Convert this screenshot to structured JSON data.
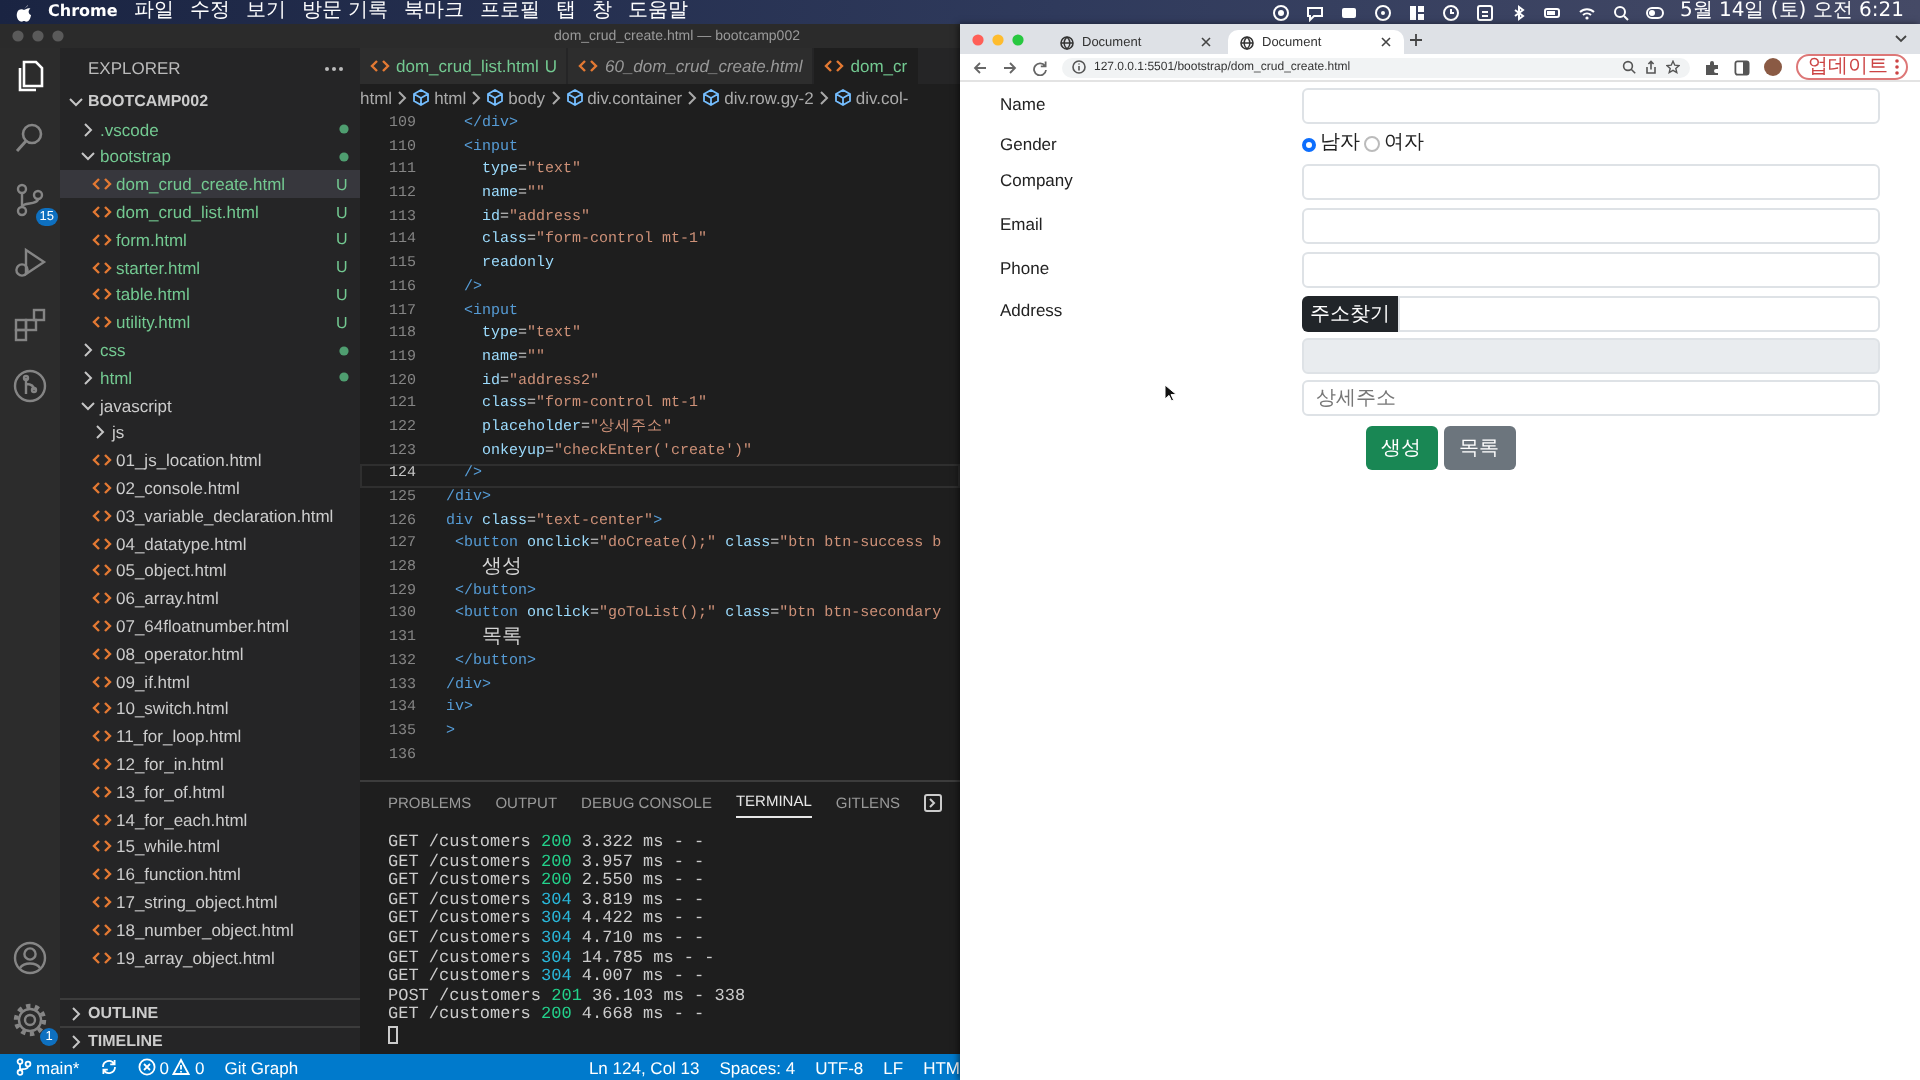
{
  "menu_bar": {
    "app": "Chrome",
    "menus": [
      "파일",
      "수정",
      "보기",
      "방문 기록",
      "북마크",
      "프로필",
      "탭",
      "창",
      "도움말"
    ],
    "clock": "5월 14일 (토) 오전 6:21"
  },
  "editor_window": {
    "title": "dom_crud_create.html — bootcamp002",
    "focused": false,
    "activity_bar": {
      "items": [
        {
          "kind": "files",
          "selected": true
        },
        {
          "kind": "search",
          "selected": false
        },
        {
          "kind": "source_control",
          "selected": false,
          "badge": "15"
        },
        {
          "kind": "run_debug",
          "selected": false
        },
        {
          "kind": "extensions",
          "selected": false
        },
        {
          "kind": "git_graph",
          "selected": false
        }
      ],
      "bottom_items": [
        {
          "kind": "account",
          "selected": false
        },
        {
          "kind": "settings",
          "selected": false,
          "badge": "1"
        }
      ]
    },
    "sidebar": {
      "title": "EXPLORER",
      "root": {
        "label": "BOOTCAMP002",
        "expanded": true
      },
      "tree": [
        {
          "label": ".vscode",
          "kind": "folder",
          "expanded": false,
          "untracked": true,
          "selected": false
        },
        {
          "label": "bootstrap",
          "kind": "folder",
          "expanded": true,
          "untracked": true,
          "selected": false,
          "children": [
            {
              "label": "dom_crud_create.html",
              "kind": "file",
              "untracked": true,
              "badge": "U",
              "selected": true
            },
            {
              "label": "dom_crud_list.html",
              "kind": "file",
              "untracked": true,
              "badge": "U",
              "selected": false
            },
            {
              "label": "form.html",
              "kind": "file",
              "untracked": true,
              "badge": "U",
              "selected": false
            },
            {
              "label": "starter.html",
              "kind": "file",
              "untracked": true,
              "badge": "U",
              "selected": false
            },
            {
              "label": "table.html",
              "kind": "file",
              "untracked": true,
              "badge": "U",
              "selected": false
            },
            {
              "label": "utility.html",
              "kind": "file",
              "untracked": true,
              "badge": "U",
              "selected": false
            }
          ]
        },
        {
          "label": "css",
          "kind": "folder",
          "expanded": false,
          "untracked": true,
          "selected": false
        },
        {
          "label": "html",
          "kind": "folder",
          "expanded": false,
          "untracked": true,
          "selected": false
        },
        {
          "label": "javascript",
          "kind": "folder",
          "expanded": true,
          "untracked": false,
          "selected": false,
          "children": [
            {
              "label": "js",
              "kind": "folder",
              "expanded": false,
              "untracked": false,
              "selected": false
            },
            {
              "label": "01_js_location.html",
              "kind": "file",
              "untracked": false,
              "selected": false
            },
            {
              "label": "02_console.html",
              "kind": "file",
              "untracked": false,
              "selected": false
            },
            {
              "label": "03_variable_declaration.html",
              "kind": "file",
              "untracked": false,
              "selected": false
            },
            {
              "label": "04_datatype.html",
              "kind": "file",
              "untracked": false,
              "selected": false
            },
            {
              "label": "05_object.html",
              "kind": "file",
              "untracked": false,
              "selected": false
            },
            {
              "label": "06_array.html",
              "kind": "file",
              "untracked": false,
              "selected": false
            },
            {
              "label": "07_64floatnumber.html",
              "kind": "file",
              "untracked": false,
              "selected": false
            },
            {
              "label": "08_operator.html",
              "kind": "file",
              "untracked": false,
              "selected": false
            },
            {
              "label": "09_if.html",
              "kind": "file",
              "untracked": false,
              "selected": false
            },
            {
              "label": "10_switch.html",
              "kind": "file",
              "untracked": false,
              "selected": false
            },
            {
              "label": "11_for_loop.html",
              "kind": "file",
              "untracked": false,
              "selected": false
            },
            {
              "label": "12_for_in.html",
              "kind": "file",
              "untracked": false,
              "selected": false
            },
            {
              "label": "13_for_of.html",
              "kind": "file",
              "untracked": false,
              "selected": false
            },
            {
              "label": "14_for_each.html",
              "kind": "file",
              "untracked": false,
              "selected": false
            },
            {
              "label": "15_while.html",
              "kind": "file",
              "untracked": false,
              "selected": false
            },
            {
              "label": "16_function.html",
              "kind": "file",
              "untracked": false,
              "selected": false
            },
            {
              "label": "17_string_object.html",
              "kind": "file",
              "untracked": false,
              "selected": false
            },
            {
              "label": "18_number_object.html",
              "kind": "file",
              "untracked": false,
              "selected": false
            },
            {
              "label": "19_array_object.html",
              "kind": "file",
              "untracked": false,
              "selected": false
            }
          ]
        }
      ],
      "sections": [
        {
          "label": "OUTLINE",
          "expanded": false
        },
        {
          "label": "TIMELINE",
          "expanded": false
        }
      ]
    },
    "tabs": [
      {
        "label": "dom_crud_list.html",
        "badge": "U",
        "untracked": true,
        "preview": false,
        "selected": false
      },
      {
        "label": "60_dom_crud_create.html",
        "untracked": false,
        "preview": true,
        "selected": false
      },
      {
        "label": "dom_cr",
        "untracked": true,
        "preview": false,
        "selected": true
      }
    ],
    "breadcrumb": [
      {
        "label": "html",
        "kind": "folder"
      },
      {
        "label": "html",
        "kind": "element"
      },
      {
        "label": "body",
        "kind": "element"
      },
      {
        "label": "div.container",
        "kind": "element"
      },
      {
        "label": "div.row.gy-2",
        "kind": "element"
      },
      {
        "label": "div.col-",
        "kind": "element"
      }
    ],
    "code": {
      "lines": [
        {
          "number": "109",
          "current": false,
          "tokens": [
            {
              "kind": "tag",
              "text": "  </div>"
            }
          ]
        },
        {
          "number": "110",
          "current": false,
          "tokens": [
            {
              "kind": "tag",
              "text": "  <input"
            }
          ]
        },
        {
          "number": "111",
          "current": false,
          "tokens": [
            {
              "kind": "attr",
              "text": "    type"
            },
            {
              "kind": "punct",
              "text": "="
            },
            {
              "kind": "string",
              "text": "\"text\""
            }
          ]
        },
        {
          "number": "112",
          "current": false,
          "tokens": [
            {
              "kind": "attr",
              "text": "    name"
            },
            {
              "kind": "punct",
              "text": "="
            },
            {
              "kind": "string",
              "text": "\"\""
            }
          ]
        },
        {
          "number": "113",
          "current": false,
          "tokens": [
            {
              "kind": "attr",
              "text": "    id"
            },
            {
              "kind": "punct",
              "text": "="
            },
            {
              "kind": "string",
              "text": "\"address\""
            }
          ]
        },
        {
          "number": "114",
          "current": false,
          "tokens": [
            {
              "kind": "attr",
              "text": "    class"
            },
            {
              "kind": "punct",
              "text": "="
            },
            {
              "kind": "string",
              "text": "\"form-control mt-1\""
            }
          ]
        },
        {
          "number": "115",
          "current": false,
          "tokens": [
            {
              "kind": "attr",
              "text": "    readonly"
            }
          ]
        },
        {
          "number": "116",
          "current": false,
          "tokens": [
            {
              "kind": "tag",
              "text": "  />"
            }
          ]
        },
        {
          "number": "117",
          "current": false,
          "tokens": [
            {
              "kind": "tag",
              "text": "  <input"
            }
          ]
        },
        {
          "number": "118",
          "current": false,
          "tokens": [
            {
              "kind": "attr",
              "text": "    type"
            },
            {
              "kind": "punct",
              "text": "="
            },
            {
              "kind": "string",
              "text": "\"text\""
            }
          ]
        },
        {
          "number": "119",
          "current": false,
          "tokens": [
            {
              "kind": "attr",
              "text": "    name"
            },
            {
              "kind": "punct",
              "text": "="
            },
            {
              "kind": "string",
              "text": "\"\""
            }
          ]
        },
        {
          "number": "120",
          "current": false,
          "tokens": [
            {
              "kind": "attr",
              "text": "    id"
            },
            {
              "kind": "punct",
              "text": "="
            },
            {
              "kind": "string",
              "text": "\"address2\""
            }
          ]
        },
        {
          "number": "121",
          "current": false,
          "tokens": [
            {
              "kind": "attr",
              "text": "    class"
            },
            {
              "kind": "punct",
              "text": "="
            },
            {
              "kind": "string",
              "text": "\"form-control mt-1\""
            }
          ]
        },
        {
          "number": "122",
          "current": false,
          "tokens": [
            {
              "kind": "attr",
              "text": "    placeholder"
            },
            {
              "kind": "punct",
              "text": "="
            },
            {
              "kind": "string",
              "text": "\"상세주소\""
            }
          ]
        },
        {
          "number": "123",
          "current": false,
          "tokens": [
            {
              "kind": "attr",
              "text": "    onkeyup"
            },
            {
              "kind": "punct",
              "text": "="
            },
            {
              "kind": "string",
              "text": "\"checkEnter('create')\""
            }
          ]
        },
        {
          "number": "124",
          "current": true,
          "tokens": [
            {
              "kind": "tag",
              "text": "  />"
            }
          ]
        },
        {
          "number": "125",
          "current": false,
          "tokens": [
            {
              "kind": "tag",
              "text": "/div>"
            }
          ]
        },
        {
          "number": "126",
          "current": false,
          "tokens": [
            {
              "kind": "tag",
              "text": "div"
            },
            {
              "kind": "attr",
              "text": " class"
            },
            {
              "kind": "punct",
              "text": "="
            },
            {
              "kind": "string",
              "text": "\"text-center\""
            },
            {
              "kind": "tag",
              "text": ">"
            }
          ]
        },
        {
          "number": "127",
          "current": false,
          "tokens": [
            {
              "kind": "tag",
              "text": " <button"
            },
            {
              "kind": "attr",
              "text": " onclick"
            },
            {
              "kind": "punct",
              "text": "="
            },
            {
              "kind": "string",
              "text": "\"doCreate();\""
            },
            {
              "kind": "attr",
              "text": " class"
            },
            {
              "kind": "punct",
              "text": "="
            },
            {
              "kind": "string",
              "text": "\"btn btn-success b"
            }
          ]
        },
        {
          "number": "128",
          "current": false,
          "tokens": [
            {
              "kind": "text",
              "text": "   생성"
            }
          ]
        },
        {
          "number": "129",
          "current": false,
          "tokens": [
            {
              "kind": "tag",
              "text": " </button>"
            }
          ]
        },
        {
          "number": "130",
          "current": false,
          "tokens": [
            {
              "kind": "tag",
              "text": " <button"
            },
            {
              "kind": "attr",
              "text": " onclick"
            },
            {
              "kind": "punct",
              "text": "="
            },
            {
              "kind": "string",
              "text": "\"goToList();\""
            },
            {
              "kind": "attr",
              "text": " class"
            },
            {
              "kind": "punct",
              "text": "="
            },
            {
              "kind": "string",
              "text": "\"btn btn-secondary"
            }
          ]
        },
        {
          "number": "131",
          "current": false,
          "tokens": [
            {
              "kind": "text",
              "text": "   목록"
            }
          ]
        },
        {
          "number": "132",
          "current": false,
          "tokens": [
            {
              "kind": "tag",
              "text": " </button>"
            }
          ]
        },
        {
          "number": "133",
          "current": false,
          "tokens": [
            {
              "kind": "tag",
              "text": "/div>"
            }
          ]
        },
        {
          "number": "134",
          "current": false,
          "tokens": [
            {
              "kind": "tag",
              "text": "iv>"
            }
          ]
        },
        {
          "number": "135",
          "current": false,
          "tokens": [
            {
              "kind": "tag",
              "text": ">"
            }
          ]
        },
        {
          "number": "136",
          "current": false
        }
      ]
    },
    "panel": {
      "tabs": [
        {
          "label": "PROBLEMS",
          "selected": false
        },
        {
          "label": "OUTPUT",
          "selected": false
        },
        {
          "label": "DEBUG CONSOLE",
          "selected": false
        },
        {
          "label": "TERMINAL",
          "selected": true
        },
        {
          "label": "GITLENS",
          "selected": false
        }
      ],
      "terminal": [
        {
          "request": "GET /customers",
          "status": "200",
          "kind": "success",
          "rest": "3.322 ms - -"
        },
        {
          "request": "GET /customers",
          "status": "200",
          "kind": "success",
          "rest": "3.957 ms - -"
        },
        {
          "request": "GET /customers",
          "status": "200",
          "kind": "success",
          "rest": "2.550 ms - -"
        },
        {
          "request": "GET /customers",
          "status": "304",
          "kind": "not_modified",
          "rest": "3.819 ms - -"
        },
        {
          "request": "GET /customers",
          "status": "304",
          "kind": "not_modified",
          "rest": "4.422 ms - -"
        },
        {
          "request": "GET /customers",
          "status": "304",
          "kind": "not_modified",
          "rest": "4.710 ms - -"
        },
        {
          "request": "GET /customers",
          "status": "304",
          "kind": "not_modified",
          "rest": "14.785 ms - -"
        },
        {
          "request": "GET /customers",
          "status": "304",
          "kind": "not_modified",
          "rest": "4.007 ms - -"
        },
        {
          "request": "POST /customers",
          "status": "201",
          "kind": "success",
          "rest": "36.103 ms - 338"
        },
        {
          "request": "GET /customers",
          "status": "200",
          "kind": "success",
          "rest": "4.668 ms - -"
        }
      ]
    },
    "status_bar": {
      "branch": "main*",
      "errors": "0",
      "warnings": "0",
      "left_items": [
        "Git Graph"
      ],
      "right_items": [
        "Ln 124, Col 13",
        "Spaces: 4",
        "UTF-8",
        "LF",
        "HTM"
      ]
    }
  },
  "browser": {
    "focused": true,
    "tabs": [
      {
        "title": "Document",
        "selected": false
      },
      {
        "title": "Document",
        "selected": true
      }
    ],
    "url": "127.0.0.1:5501/bootstrap/dom_crud_create.html",
    "update_button": "업데이트",
    "form": {
      "fields": [
        {
          "label": "Name",
          "kind": "text"
        },
        {
          "label": "Gender",
          "kind": "radio",
          "options": [
            {
              "label": "남자",
              "selected": true
            },
            {
              "label": "여자",
              "selected": false
            }
          ]
        },
        {
          "label": "Company",
          "kind": "text"
        },
        {
          "label": "Email",
          "kind": "text"
        },
        {
          "label": "Phone",
          "kind": "text"
        },
        {
          "label": "Address",
          "kind": "address",
          "button": "주소찾기",
          "inputs": [
            {
              "readonly": false
            },
            {
              "readonly": true
            },
            {
              "readonly": false,
              "placeholder": "상세주소"
            }
          ]
        }
      ],
      "buttons": [
        {
          "label": "생성",
          "kind": "success"
        },
        {
          "label": "목록",
          "kind": "secondary"
        }
      ]
    }
  }
}
